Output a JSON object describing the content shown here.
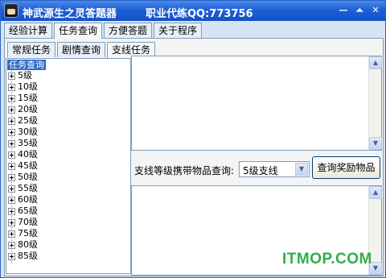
{
  "window": {
    "title": "神武源生之灵答题器",
    "contact": "职业代练QQ:773756",
    "controls": {
      "minimize": "—",
      "restore": "⏶",
      "close": "✕"
    }
  },
  "tabs": [
    {
      "label": "经验计算"
    },
    {
      "label": "任务查询"
    },
    {
      "label": "方便答题"
    },
    {
      "label": "关于程序"
    }
  ],
  "subtabs": [
    {
      "label": "常规任务"
    },
    {
      "label": "剧情查询"
    },
    {
      "label": "支线任务"
    }
  ],
  "tree": {
    "root": "任务查询",
    "items": [
      "5级",
      "10级",
      "15级",
      "20级",
      "25级",
      "30级",
      "35级",
      "40级",
      "45级",
      "50级",
      "55级",
      "60级",
      "65级",
      "70级",
      "75级",
      "80级",
      "85级"
    ]
  },
  "query": {
    "label": "支线等级携带物品查询:",
    "selected": "5级支线",
    "button": "查询奖励物品"
  },
  "watermark": "ITMOP.COM"
}
